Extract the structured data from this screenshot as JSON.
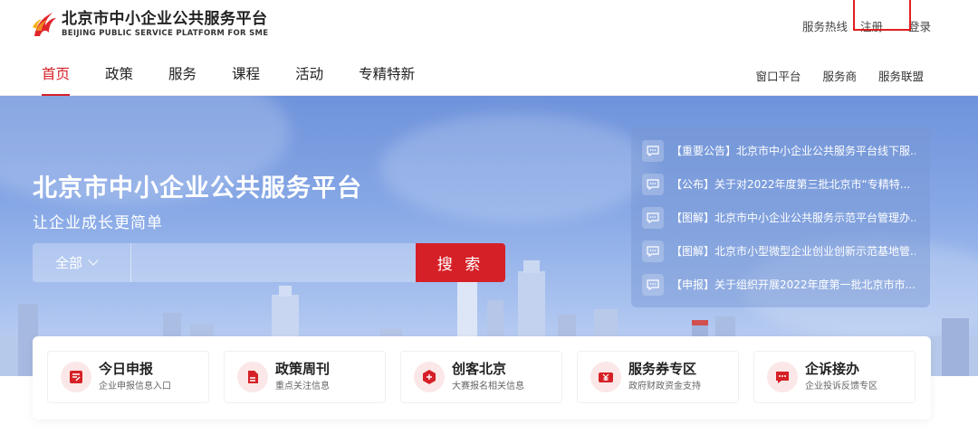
{
  "header": {
    "logo_cn": "北京市中小企业公共服务平台",
    "logo_en": "BEIJING PUBLIC SERVICE PLATFORM FOR SME",
    "hotline": "服务热线",
    "register": "注册",
    "login": "登录"
  },
  "nav": {
    "items": [
      {
        "label": "首页"
      },
      {
        "label": "政策"
      },
      {
        "label": "服务"
      },
      {
        "label": "课程"
      },
      {
        "label": "活动"
      },
      {
        "label": "专精特新"
      }
    ],
    "right": [
      {
        "label": "窗口平台"
      },
      {
        "label": "服务商"
      },
      {
        "label": "服务联盟"
      }
    ]
  },
  "hero": {
    "title": "北京市中小企业公共服务平台",
    "subtitle": "让企业成长更简单",
    "search_scope": "全部",
    "search_button": "搜 索",
    "search_placeholder": ""
  },
  "news": [
    {
      "text": "【重要公告】北京市中小企业公共服务平台线下服..."
    },
    {
      "text": "【公布】关于对2022年度第三批北京市“专精特..."
    },
    {
      "text": "【图解】北京市中小企业公共服务示范平台管理办..."
    },
    {
      "text": "【图解】北京市小型微型企业创业创新示范基地管..."
    },
    {
      "text": "【申报】关于组织开展2022年度第一批北京市市..."
    }
  ],
  "cards": [
    {
      "title": "今日申报",
      "sub": "企业申报信息入口",
      "icon": "edit-doc-icon"
    },
    {
      "title": "政策周刊",
      "sub": "重点关注信息",
      "icon": "document-icon"
    },
    {
      "title": "创客北京",
      "sub": "大赛报名相关信息",
      "icon": "badge-icon"
    },
    {
      "title": "服务券专区",
      "sub": "政府财政资金支持",
      "icon": "yuan-ticket-icon"
    },
    {
      "title": "企诉接办",
      "sub": "企业投诉反馈专区",
      "icon": "chat-icon"
    }
  ],
  "colors": {
    "brand_red": "#d62027",
    "hero_blue": "#6f93db"
  }
}
